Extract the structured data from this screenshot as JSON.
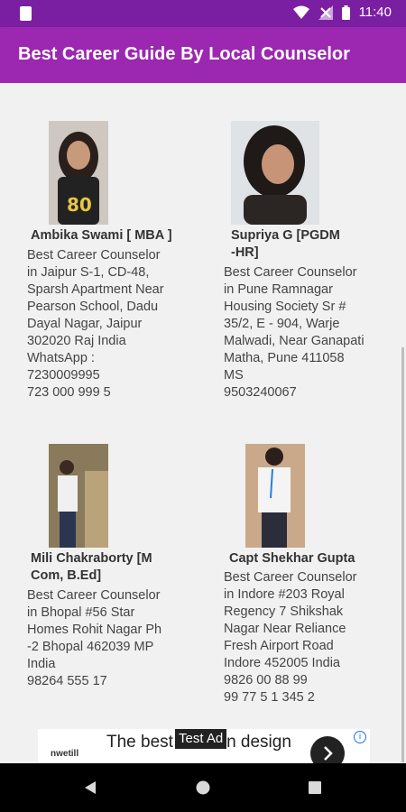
{
  "status_bar": {
    "time": "11:40"
  },
  "app_bar": {
    "title": "Best Career Guide By Local Counselor"
  },
  "counselors": [
    {
      "name": "Ambika Swami [ MBA ]",
      "desc": "Best Career Counselor\nin Jaipur S-1, CD-48,\nSparsh Apartment Near\nPearson School, Dadu\nDayal Nagar, Jaipur\n302020 Raj India\nWhatsApp :\n7230009995\n723 000 999 5"
    },
    {
      "name": "Supriya G  [PGDM\n-HR]",
      "desc": "Best Career Counselor\nin Pune Ramnagar\nHousing Society Sr #\n35/2, E - 904, Warje\nMalwadi, Near Ganapati\nMatha, Pune 411058\nMS\n9503240067"
    },
    {
      "name": "Mili Chakraborty [M\nCom, B.Ed]",
      "desc": "Best Career Counselor\nin Bhopal #56 Star\nHomes Rohit Nagar Ph\n-2 Bhopal 462039 MP\nIndia\n98264 555 17"
    },
    {
      "name": "Capt Shekhar Gupta",
      "desc": "Best Career Counselor\nin Indore #203  Royal\nRegency 7 Shikshak\nNagar Near Reliance\nFresh Airport Road\nIndore 452005 India\n9826 00 88 99\n99 77 5 1 345 2"
    }
  ],
  "ad": {
    "brand": "nwetill",
    "headline": "The best modern design",
    "tag": "Test Ad"
  }
}
